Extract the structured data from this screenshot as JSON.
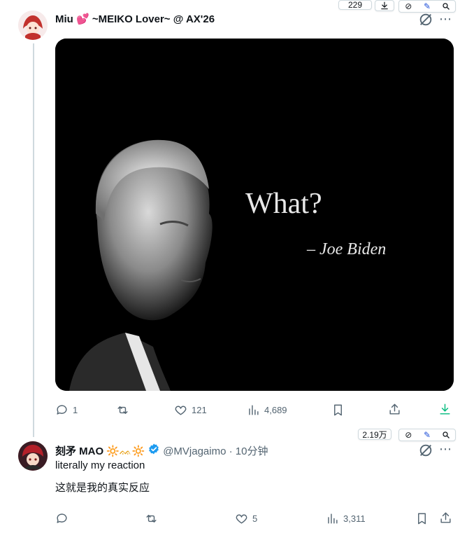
{
  "tweet1": {
    "display_name": "Miu 💕 ~MEIKO Lover~ @ AX'26",
    "counter_badge": "229",
    "actions": {
      "replies": "1",
      "likes": "121",
      "views": "4,689"
    },
    "image_text": {
      "headline": "What?",
      "attribution": "– Joe Biden"
    }
  },
  "tweet2": {
    "display_name": "刻矛 MAO",
    "emojis": "🔆ᨐ🔆",
    "handle_time": "@MVjagaimo · 10分钟",
    "counter_badge": "2.19万",
    "text_line1": "literally my reaction",
    "text_line2": "这就是我的真实反应",
    "actions": {
      "likes": "5",
      "views": "3,311"
    }
  },
  "icons": {
    "more": "more-icon",
    "grok": "grok-icon",
    "reply": "reply-icon",
    "retweet": "retweet-icon",
    "like": "like-icon",
    "views": "views-icon",
    "bookmark": "bookmark-icon",
    "share": "share-icon",
    "download": "download-icon",
    "verified": "verified-icon"
  },
  "colors": {
    "accent": "#1d9bf0",
    "muted": "#536471",
    "download_green": "#00ba7c"
  }
}
